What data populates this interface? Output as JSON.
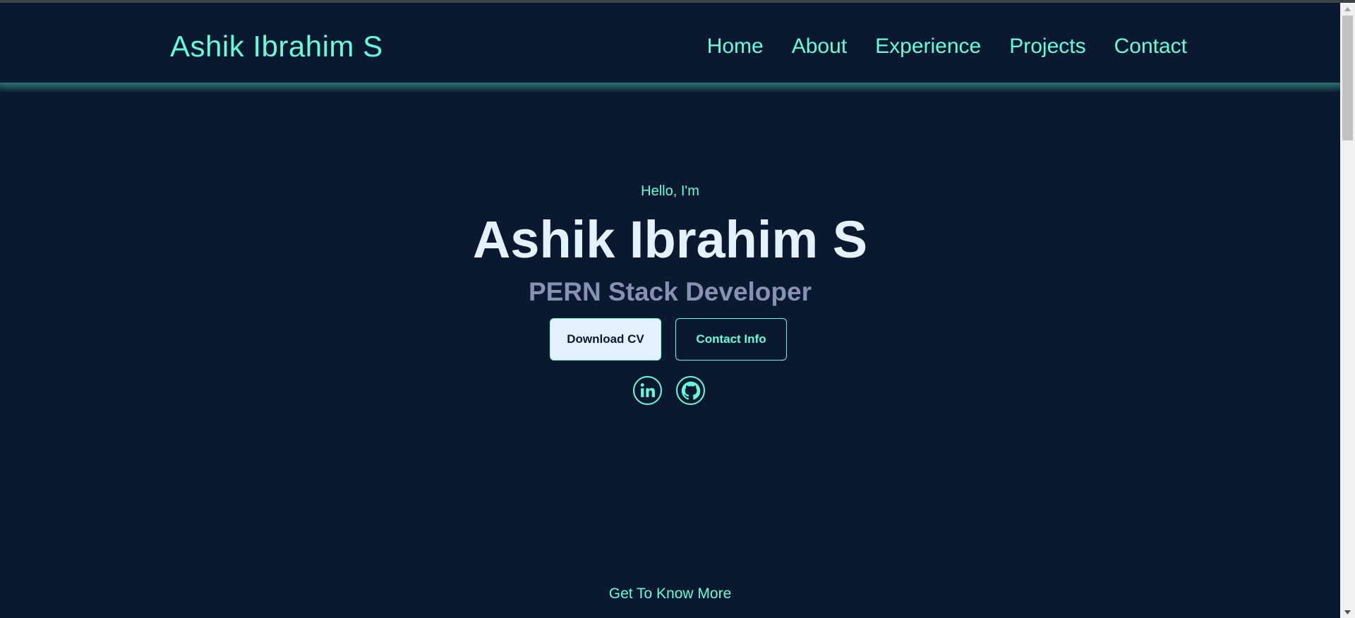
{
  "brand": {
    "title": "Ashik Ibrahim S"
  },
  "nav": {
    "items": [
      {
        "label": "Home"
      },
      {
        "label": "About"
      },
      {
        "label": "Experience"
      },
      {
        "label": "Projects"
      },
      {
        "label": "Contact"
      }
    ]
  },
  "hero": {
    "greeting": "Hello, I'm",
    "name": "Ashik Ibrahim S",
    "role": "PERN Stack Developer",
    "download_cv_label": "Download CV",
    "contact_info_label": "Contact Info"
  },
  "socials": [
    {
      "icon": "linkedin-icon"
    },
    {
      "icon": "github-icon"
    }
  ],
  "footer_link": {
    "label": "Get To Know More"
  },
  "colors": {
    "background": "#0a192f",
    "accent": "#64ffda",
    "heading": "#e6f1ff",
    "muted": "#8892b0"
  }
}
